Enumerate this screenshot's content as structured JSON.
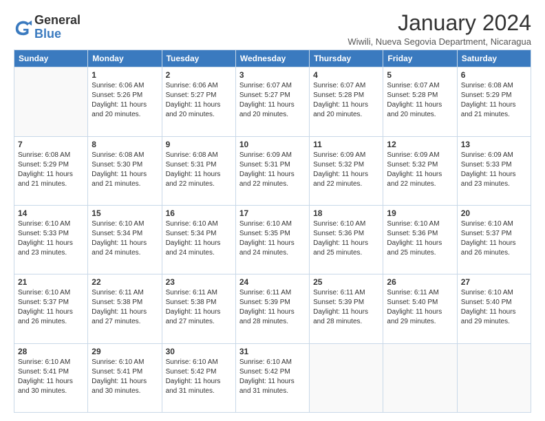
{
  "header": {
    "logo_general": "General",
    "logo_blue": "Blue",
    "month_title": "January 2024",
    "location": "Wiwili, Nueva Segovia Department, Nicaragua"
  },
  "weekdays": [
    "Sunday",
    "Monday",
    "Tuesday",
    "Wednesday",
    "Thursday",
    "Friday",
    "Saturday"
  ],
  "weeks": [
    [
      {
        "day": "",
        "text": ""
      },
      {
        "day": "1",
        "text": "Sunrise: 6:06 AM\nSunset: 5:26 PM\nDaylight: 11 hours\nand 20 minutes."
      },
      {
        "day": "2",
        "text": "Sunrise: 6:06 AM\nSunset: 5:27 PM\nDaylight: 11 hours\nand 20 minutes."
      },
      {
        "day": "3",
        "text": "Sunrise: 6:07 AM\nSunset: 5:27 PM\nDaylight: 11 hours\nand 20 minutes."
      },
      {
        "day": "4",
        "text": "Sunrise: 6:07 AM\nSunset: 5:28 PM\nDaylight: 11 hours\nand 20 minutes."
      },
      {
        "day": "5",
        "text": "Sunrise: 6:07 AM\nSunset: 5:28 PM\nDaylight: 11 hours\nand 20 minutes."
      },
      {
        "day": "6",
        "text": "Sunrise: 6:08 AM\nSunset: 5:29 PM\nDaylight: 11 hours\nand 21 minutes."
      }
    ],
    [
      {
        "day": "7",
        "text": "Sunrise: 6:08 AM\nSunset: 5:29 PM\nDaylight: 11 hours\nand 21 minutes."
      },
      {
        "day": "8",
        "text": "Sunrise: 6:08 AM\nSunset: 5:30 PM\nDaylight: 11 hours\nand 21 minutes."
      },
      {
        "day": "9",
        "text": "Sunrise: 6:08 AM\nSunset: 5:31 PM\nDaylight: 11 hours\nand 22 minutes."
      },
      {
        "day": "10",
        "text": "Sunrise: 6:09 AM\nSunset: 5:31 PM\nDaylight: 11 hours\nand 22 minutes."
      },
      {
        "day": "11",
        "text": "Sunrise: 6:09 AM\nSunset: 5:32 PM\nDaylight: 11 hours\nand 22 minutes."
      },
      {
        "day": "12",
        "text": "Sunrise: 6:09 AM\nSunset: 5:32 PM\nDaylight: 11 hours\nand 22 minutes."
      },
      {
        "day": "13",
        "text": "Sunrise: 6:09 AM\nSunset: 5:33 PM\nDaylight: 11 hours\nand 23 minutes."
      }
    ],
    [
      {
        "day": "14",
        "text": "Sunrise: 6:10 AM\nSunset: 5:33 PM\nDaylight: 11 hours\nand 23 minutes."
      },
      {
        "day": "15",
        "text": "Sunrise: 6:10 AM\nSunset: 5:34 PM\nDaylight: 11 hours\nand 24 minutes."
      },
      {
        "day": "16",
        "text": "Sunrise: 6:10 AM\nSunset: 5:34 PM\nDaylight: 11 hours\nand 24 minutes."
      },
      {
        "day": "17",
        "text": "Sunrise: 6:10 AM\nSunset: 5:35 PM\nDaylight: 11 hours\nand 24 minutes."
      },
      {
        "day": "18",
        "text": "Sunrise: 6:10 AM\nSunset: 5:36 PM\nDaylight: 11 hours\nand 25 minutes."
      },
      {
        "day": "19",
        "text": "Sunrise: 6:10 AM\nSunset: 5:36 PM\nDaylight: 11 hours\nand 25 minutes."
      },
      {
        "day": "20",
        "text": "Sunrise: 6:10 AM\nSunset: 5:37 PM\nDaylight: 11 hours\nand 26 minutes."
      }
    ],
    [
      {
        "day": "21",
        "text": "Sunrise: 6:10 AM\nSunset: 5:37 PM\nDaylight: 11 hours\nand 26 minutes."
      },
      {
        "day": "22",
        "text": "Sunrise: 6:11 AM\nSunset: 5:38 PM\nDaylight: 11 hours\nand 27 minutes."
      },
      {
        "day": "23",
        "text": "Sunrise: 6:11 AM\nSunset: 5:38 PM\nDaylight: 11 hours\nand 27 minutes."
      },
      {
        "day": "24",
        "text": "Sunrise: 6:11 AM\nSunset: 5:39 PM\nDaylight: 11 hours\nand 28 minutes."
      },
      {
        "day": "25",
        "text": "Sunrise: 6:11 AM\nSunset: 5:39 PM\nDaylight: 11 hours\nand 28 minutes."
      },
      {
        "day": "26",
        "text": "Sunrise: 6:11 AM\nSunset: 5:40 PM\nDaylight: 11 hours\nand 29 minutes."
      },
      {
        "day": "27",
        "text": "Sunrise: 6:10 AM\nSunset: 5:40 PM\nDaylight: 11 hours\nand 29 minutes."
      }
    ],
    [
      {
        "day": "28",
        "text": "Sunrise: 6:10 AM\nSunset: 5:41 PM\nDaylight: 11 hours\nand 30 minutes."
      },
      {
        "day": "29",
        "text": "Sunrise: 6:10 AM\nSunset: 5:41 PM\nDaylight: 11 hours\nand 30 minutes."
      },
      {
        "day": "30",
        "text": "Sunrise: 6:10 AM\nSunset: 5:42 PM\nDaylight: 11 hours\nand 31 minutes."
      },
      {
        "day": "31",
        "text": "Sunrise: 6:10 AM\nSunset: 5:42 PM\nDaylight: 11 hours\nand 31 minutes."
      },
      {
        "day": "",
        "text": ""
      },
      {
        "day": "",
        "text": ""
      },
      {
        "day": "",
        "text": ""
      }
    ]
  ]
}
